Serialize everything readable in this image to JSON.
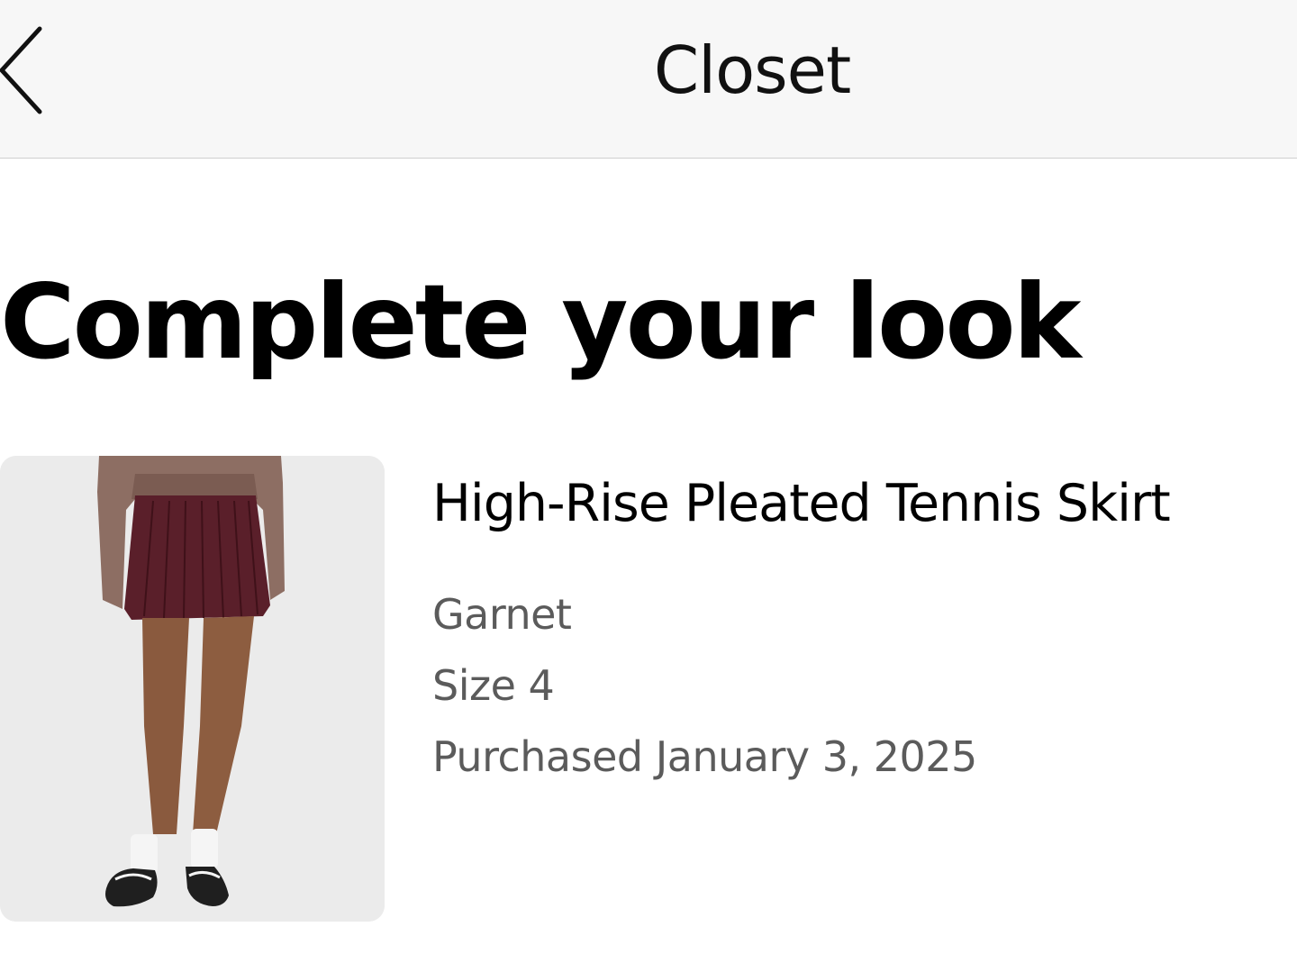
{
  "header": {
    "title": "Closet",
    "back_icon": "chevron-left-icon"
  },
  "section": {
    "heading": "Complete your look"
  },
  "product": {
    "name": "High-Rise Pleated Tennis Skirt",
    "color": "Garnet",
    "size": "Size 4",
    "purchased": "Purchased January 3, 2025",
    "image_icon": "product-photo"
  },
  "colors": {
    "header_bg": "#f7f7f7",
    "header_border": "#cfcfcf",
    "text_primary": "#000000",
    "text_secondary": "#5b5b5b",
    "image_bg": "#ececec",
    "skirt": "#5a1f2a"
  }
}
